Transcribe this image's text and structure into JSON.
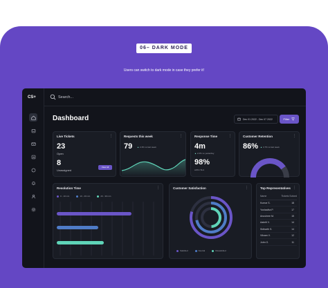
{
  "section": {
    "tag": "06– DARK MODE",
    "caption": "Users can switch to dark mode in case they prefer it!"
  },
  "app": {
    "logo": "CS+",
    "search_placeholder": "Search...",
    "title": "Dashboard",
    "date_range": "Dec 01 2022 - Dec 07 2022",
    "filter_label": "Filter",
    "nav_icons": [
      "home-icon",
      "inbox-icon",
      "mail-icon",
      "reports-icon",
      "chat-icon",
      "bell-icon",
      "user-icon",
      "settings-icon"
    ]
  },
  "cards": {
    "live_tickets": {
      "title": "Live Tickets",
      "open_count": "23",
      "open_label": "Open",
      "unassigned_count": "8",
      "unassigned_label": "Unassigned",
      "button_label": "View All"
    },
    "requests": {
      "title": "Requests this week",
      "value": "79",
      "delta": "2.4% vs last week"
    },
    "response_time": {
      "title": "Response Time",
      "value": "4m",
      "delta": "2.2% vs yesterday",
      "sla_value": "98%",
      "sla_label": "within SLA"
    },
    "retention": {
      "title": "Customer Retention",
      "value": "86%",
      "delta": "4.7% vs last week"
    },
    "resolution": {
      "title": "Resolution Time",
      "legend": [
        "0 - 10 min",
        "10 - 20 min",
        "20 - 30 min"
      ]
    },
    "satisfaction": {
      "title": "Customer Satisfaction",
      "legend": [
        "Satisfied",
        "Neutral",
        "Dissatisfied"
      ]
    },
    "top_reps": {
      "title": "Top Representatives",
      "col_name": "Name",
      "col_tickets": "Tickets Solved",
      "rows": [
        {
          "name": "Kumar S.",
          "tickets": "18"
        },
        {
          "name": "Yoshadha P.",
          "tickets": "17"
        },
        {
          "name": "Anushree M.",
          "tickets": "15"
        },
        {
          "name": "Aakriti V.",
          "tickets": "14"
        },
        {
          "name": "Sidharth S.",
          "tickets": "14"
        },
        {
          "name": "Vikram V.",
          "tickets": "12"
        },
        {
          "name": "John G.",
          "tickets": "11"
        }
      ]
    }
  },
  "colors": {
    "accent": "#6a55c7",
    "teal": "#5fd4b8",
    "blue": "#4f7cc7",
    "purple_bg": "#6447c4"
  }
}
